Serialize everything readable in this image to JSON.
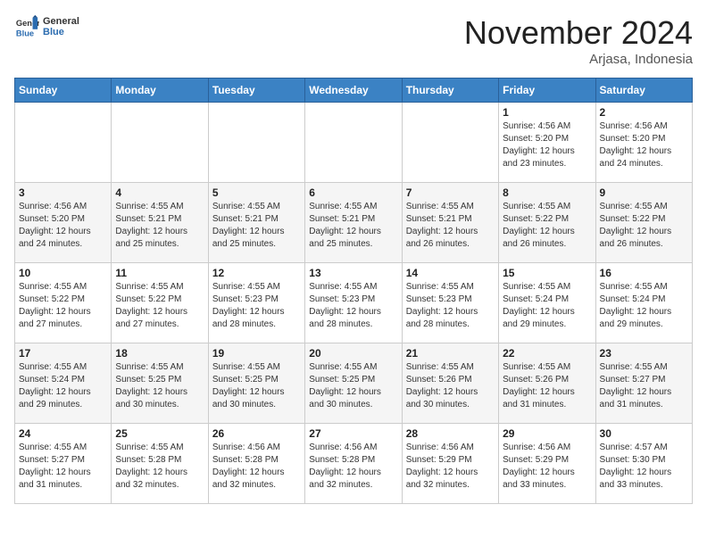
{
  "header": {
    "logo_general": "General",
    "logo_blue": "Blue",
    "month_title": "November 2024",
    "location": "Arjasa, Indonesia"
  },
  "weekdays": [
    "Sunday",
    "Monday",
    "Tuesday",
    "Wednesday",
    "Thursday",
    "Friday",
    "Saturday"
  ],
  "weeks": [
    [
      {
        "day": "",
        "info": ""
      },
      {
        "day": "",
        "info": ""
      },
      {
        "day": "",
        "info": ""
      },
      {
        "day": "",
        "info": ""
      },
      {
        "day": "",
        "info": ""
      },
      {
        "day": "1",
        "info": "Sunrise: 4:56 AM\nSunset: 5:20 PM\nDaylight: 12 hours and 23 minutes."
      },
      {
        "day": "2",
        "info": "Sunrise: 4:56 AM\nSunset: 5:20 PM\nDaylight: 12 hours and 24 minutes."
      }
    ],
    [
      {
        "day": "3",
        "info": "Sunrise: 4:56 AM\nSunset: 5:20 PM\nDaylight: 12 hours and 24 minutes."
      },
      {
        "day": "4",
        "info": "Sunrise: 4:55 AM\nSunset: 5:21 PM\nDaylight: 12 hours and 25 minutes."
      },
      {
        "day": "5",
        "info": "Sunrise: 4:55 AM\nSunset: 5:21 PM\nDaylight: 12 hours and 25 minutes."
      },
      {
        "day": "6",
        "info": "Sunrise: 4:55 AM\nSunset: 5:21 PM\nDaylight: 12 hours and 25 minutes."
      },
      {
        "day": "7",
        "info": "Sunrise: 4:55 AM\nSunset: 5:21 PM\nDaylight: 12 hours and 26 minutes."
      },
      {
        "day": "8",
        "info": "Sunrise: 4:55 AM\nSunset: 5:22 PM\nDaylight: 12 hours and 26 minutes."
      },
      {
        "day": "9",
        "info": "Sunrise: 4:55 AM\nSunset: 5:22 PM\nDaylight: 12 hours and 26 minutes."
      }
    ],
    [
      {
        "day": "10",
        "info": "Sunrise: 4:55 AM\nSunset: 5:22 PM\nDaylight: 12 hours and 27 minutes."
      },
      {
        "day": "11",
        "info": "Sunrise: 4:55 AM\nSunset: 5:22 PM\nDaylight: 12 hours and 27 minutes."
      },
      {
        "day": "12",
        "info": "Sunrise: 4:55 AM\nSunset: 5:23 PM\nDaylight: 12 hours and 28 minutes."
      },
      {
        "day": "13",
        "info": "Sunrise: 4:55 AM\nSunset: 5:23 PM\nDaylight: 12 hours and 28 minutes."
      },
      {
        "day": "14",
        "info": "Sunrise: 4:55 AM\nSunset: 5:23 PM\nDaylight: 12 hours and 28 minutes."
      },
      {
        "day": "15",
        "info": "Sunrise: 4:55 AM\nSunset: 5:24 PM\nDaylight: 12 hours and 29 minutes."
      },
      {
        "day": "16",
        "info": "Sunrise: 4:55 AM\nSunset: 5:24 PM\nDaylight: 12 hours and 29 minutes."
      }
    ],
    [
      {
        "day": "17",
        "info": "Sunrise: 4:55 AM\nSunset: 5:24 PM\nDaylight: 12 hours and 29 minutes."
      },
      {
        "day": "18",
        "info": "Sunrise: 4:55 AM\nSunset: 5:25 PM\nDaylight: 12 hours and 30 minutes."
      },
      {
        "day": "19",
        "info": "Sunrise: 4:55 AM\nSunset: 5:25 PM\nDaylight: 12 hours and 30 minutes."
      },
      {
        "day": "20",
        "info": "Sunrise: 4:55 AM\nSunset: 5:25 PM\nDaylight: 12 hours and 30 minutes."
      },
      {
        "day": "21",
        "info": "Sunrise: 4:55 AM\nSunset: 5:26 PM\nDaylight: 12 hours and 30 minutes."
      },
      {
        "day": "22",
        "info": "Sunrise: 4:55 AM\nSunset: 5:26 PM\nDaylight: 12 hours and 31 minutes."
      },
      {
        "day": "23",
        "info": "Sunrise: 4:55 AM\nSunset: 5:27 PM\nDaylight: 12 hours and 31 minutes."
      }
    ],
    [
      {
        "day": "24",
        "info": "Sunrise: 4:55 AM\nSunset: 5:27 PM\nDaylight: 12 hours and 31 minutes."
      },
      {
        "day": "25",
        "info": "Sunrise: 4:55 AM\nSunset: 5:28 PM\nDaylight: 12 hours and 32 minutes."
      },
      {
        "day": "26",
        "info": "Sunrise: 4:56 AM\nSunset: 5:28 PM\nDaylight: 12 hours and 32 minutes."
      },
      {
        "day": "27",
        "info": "Sunrise: 4:56 AM\nSunset: 5:28 PM\nDaylight: 12 hours and 32 minutes."
      },
      {
        "day": "28",
        "info": "Sunrise: 4:56 AM\nSunset: 5:29 PM\nDaylight: 12 hours and 32 minutes."
      },
      {
        "day": "29",
        "info": "Sunrise: 4:56 AM\nSunset: 5:29 PM\nDaylight: 12 hours and 33 minutes."
      },
      {
        "day": "30",
        "info": "Sunrise: 4:57 AM\nSunset: 5:30 PM\nDaylight: 12 hours and 33 minutes."
      }
    ]
  ]
}
